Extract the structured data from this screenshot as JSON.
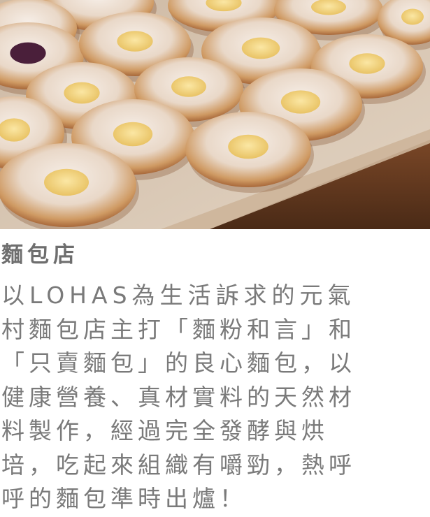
{
  "hero_image": {
    "subject": "bakery-buns-photo",
    "colors": {
      "crust": "#c98f55",
      "sugar": "#f4ece4",
      "custard": "#f1d27a",
      "jam": "#4a1f3a",
      "paper": "#d9c9b6",
      "board": "#6b3d22"
    }
  },
  "article": {
    "title": "麵包店",
    "lines": [
      "以LOHAS為生活訴求的元氣",
      "村麵包店主打「麵粉和言」和",
      "「只賣麵包」的良心麵包，以",
      "健康營養、真材實料的天然材",
      "料製作，經過完全發酵與烘",
      "培，吃起來組織有嚼勁，熱呼",
      "呼的麵包準時出爐！"
    ]
  }
}
